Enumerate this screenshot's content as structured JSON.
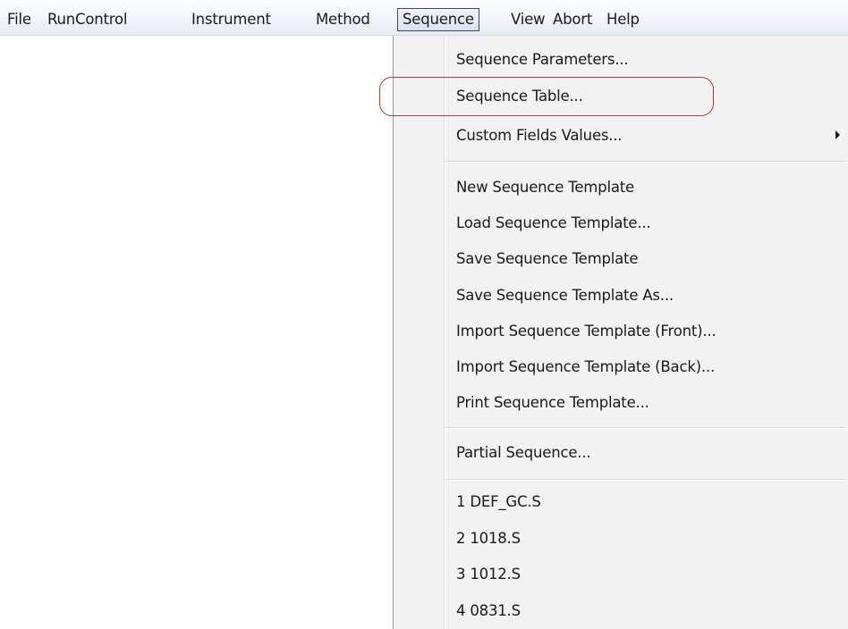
{
  "menubar": {
    "items": [
      {
        "label": "File"
      },
      {
        "label": "RunControl"
      },
      {
        "label": "Instrument"
      },
      {
        "label": "Method"
      },
      {
        "label": "Sequence"
      },
      {
        "label": "View"
      },
      {
        "label": "Abort"
      },
      {
        "label": "Help"
      }
    ],
    "active": "Sequence"
  },
  "sequence_menu": {
    "items": [
      {
        "label": "Sequence Parameters..."
      },
      {
        "label": "Sequence Table..."
      },
      {
        "label": "Custom Fields Values..."
      },
      {
        "label": "New Sequence Template"
      },
      {
        "label": "Load Sequence Template..."
      },
      {
        "label": "Save Sequence Template"
      },
      {
        "label": "Save Sequence Template As..."
      },
      {
        "label": "Import Sequence Template (Front)..."
      },
      {
        "label": "Import Sequence Template (Back)..."
      },
      {
        "label": "Print Sequence Template..."
      },
      {
        "label": "Partial Sequence..."
      },
      {
        "label": "1 DEF_GC.S"
      },
      {
        "label": "2 1018.S"
      },
      {
        "label": "3 1012.S"
      },
      {
        "label": "4 0831.S"
      }
    ],
    "highlighted": "Sequence Table...",
    "submenu_icon": "triangle-right-icon",
    "highlight_color": "#c0392b"
  }
}
